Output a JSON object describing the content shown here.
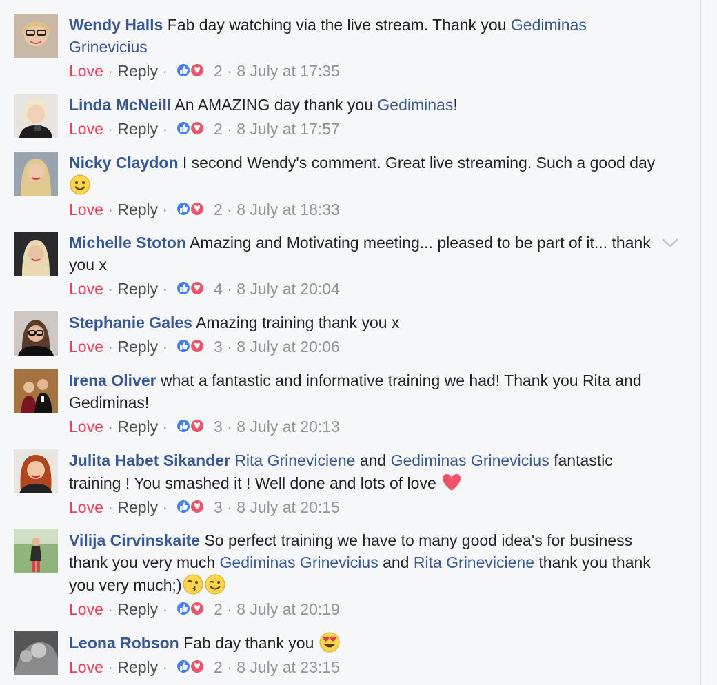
{
  "colors": {
    "background": "#f6f7f9",
    "name": "#365899",
    "mention": "#385898",
    "love": "#f33e58",
    "meta": "#90949c"
  },
  "comments": [
    {
      "name": "Wendy Halls",
      "segments": [
        {
          "type": "text",
          "value": "Fab day watching via the live stream. Thank you "
        },
        {
          "type": "mention",
          "value": "Gediminas Grinevicius"
        }
      ],
      "love_label": "Love",
      "reply_label": "Reply",
      "reaction_count": "2",
      "timestamp": "8 July at 17:35",
      "avatar_icon": "avatar-icon"
    },
    {
      "name": "Linda McNeill",
      "segments": [
        {
          "type": "text",
          "value": "An AMAZING day thank you "
        },
        {
          "type": "mention",
          "value": "Gediminas"
        },
        {
          "type": "text",
          "value": "!"
        }
      ],
      "love_label": "Love",
      "reply_label": "Reply",
      "reaction_count": "2",
      "timestamp": "8 July at 17:57",
      "avatar_icon": "avatar-icon"
    },
    {
      "name": "Nicky Claydon",
      "segments": [
        {
          "type": "text",
          "value": "I second Wendy's comment. Great live streaming. Such a good day "
        },
        {
          "type": "emoji",
          "value": "smile-emoji"
        }
      ],
      "love_label": "Love",
      "reply_label": "Reply",
      "reaction_count": "2",
      "timestamp": "8 July at 18:33",
      "avatar_icon": "avatar-icon"
    },
    {
      "name": "Michelle Stoton",
      "segments": [
        {
          "type": "text",
          "value": "Amazing and Motivating meeting... pleased to be part of it... thank you x"
        }
      ],
      "love_label": "Love",
      "reply_label": "Reply",
      "reaction_count": "4",
      "timestamp": "8 July at 20:04",
      "avatar_icon": "avatar-icon",
      "has_menu": true
    },
    {
      "name": "Stephanie Gales",
      "segments": [
        {
          "type": "text",
          "value": "Amazing training thank you x"
        }
      ],
      "love_label": "Love",
      "reply_label": "Reply",
      "reaction_count": "3",
      "timestamp": "8 July at 20:06",
      "avatar_icon": "avatar-icon"
    },
    {
      "name": "Irena Oliver",
      "segments": [
        {
          "type": "text",
          "value": "what a fantastic and informative training we had! Thank you Rita and Gediminas!"
        }
      ],
      "love_label": "Love",
      "reply_label": "Reply",
      "reaction_count": "3",
      "timestamp": "8 July at 20:13",
      "avatar_icon": "avatar-icon"
    },
    {
      "name": "Julita Habet Sikander",
      "segments": [
        {
          "type": "mention",
          "value": "Rita Grineviciene"
        },
        {
          "type": "text",
          "value": " and "
        },
        {
          "type": "mention",
          "value": "Gediminas Grinevicius"
        },
        {
          "type": "text",
          "value": " fantastic training ! You smashed it ! Well done and lots of love "
        },
        {
          "type": "emoji",
          "value": "heart-emoji"
        }
      ],
      "love_label": "Love",
      "reply_label": "Reply",
      "reaction_count": "3",
      "timestamp": "8 July at 20:15",
      "avatar_icon": "avatar-icon"
    },
    {
      "name": "Vilija Cirvinskaite",
      "segments": [
        {
          "type": "text",
          "value": "So perfect training we have to many good idea's for business thank you very much "
        },
        {
          "type": "mention",
          "value": "Gediminas Grinevicius"
        },
        {
          "type": "text",
          "value": " and "
        },
        {
          "type": "mention",
          "value": "Rita Grineviciene"
        },
        {
          "type": "text",
          "value": " thank you thank you very much;)"
        },
        {
          "type": "emoji",
          "value": "kiss-emoji"
        },
        {
          "type": "emoji",
          "value": "wink-emoji"
        }
      ],
      "love_label": "Love",
      "reply_label": "Reply",
      "reaction_count": "2",
      "timestamp": "8 July at 20:19",
      "avatar_icon": "avatar-icon"
    },
    {
      "name": "Leona Robson",
      "segments": [
        {
          "type": "text",
          "value": "Fab day thank you "
        },
        {
          "type": "emoji",
          "value": "heart-eyes-emoji"
        }
      ],
      "love_label": "Love",
      "reply_label": "Reply",
      "reaction_count": "2",
      "timestamp": "8 July at 23:15",
      "avatar_icon": "avatar-icon"
    }
  ]
}
